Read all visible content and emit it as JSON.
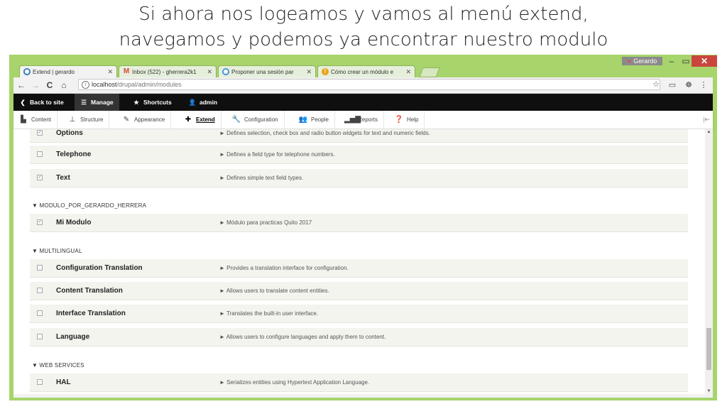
{
  "slide": {
    "title_line1": "Si ahora nos logeamos y vamos al menú extend,",
    "title_line2": "navegamos y podemos ya encontrar nuestro modulo"
  },
  "window": {
    "user": "Gerardo",
    "minimize": "–",
    "maximize": "▭",
    "close": "✕"
  },
  "tabs": [
    {
      "label": "Extend | gerardo",
      "icon": "drupal-icon",
      "color": "#2a73b8"
    },
    {
      "label": "Inbox (522) - gherrera2k1",
      "icon": "gmail-icon",
      "color": "#d44638"
    },
    {
      "label": "Proponer una sesión par",
      "icon": "drupal-icon",
      "color": "#3a8fd1"
    },
    {
      "label": "Cómo crear un módulo e",
      "icon": "info-icon",
      "color": "#e8a317"
    }
  ],
  "toolbar": {
    "back": "←",
    "forward": "→",
    "reload": "C",
    "home": "⌂",
    "url_host": "localhost",
    "url_path": "/drupal/admin/modules",
    "star": "☆"
  },
  "admin_bar": {
    "back_to_site": "Back to site",
    "manage": "Manage",
    "shortcuts": "Shortcuts",
    "admin": "admin"
  },
  "tray": {
    "items": [
      {
        "label": "Content",
        "icon": "file-icon"
      },
      {
        "label": "Structure",
        "icon": "sitemap-icon"
      },
      {
        "label": "Appearance",
        "icon": "paintbrush-icon"
      },
      {
        "label": "Extend",
        "icon": "puzzle-icon"
      },
      {
        "label": "Configuration",
        "icon": "wrench-icon"
      },
      {
        "label": "People",
        "icon": "people-icon"
      },
      {
        "label": "Reports",
        "icon": "bar-chart-icon"
      },
      {
        "label": "Help",
        "icon": "help-icon"
      }
    ],
    "active": "Extend",
    "collapse": "|⇤"
  },
  "modules": {
    "rows": [
      {
        "name": "Options",
        "desc": "Defines selection, check box and radio button widgets for text and numeric fields.",
        "checked": true
      },
      {
        "name": "Telephone",
        "desc": "Defines a field type for telephone numbers.",
        "checked": false
      },
      {
        "name": "Text",
        "desc": "Defines simple text field types.",
        "checked": true
      }
    ],
    "groups": [
      {
        "title": "MODULO_POR_GERARDO_HERRERA",
        "rows": [
          {
            "name": "Mi Modulo",
            "desc": "Módulo para practicas Quito 2017",
            "checked": true
          }
        ]
      },
      {
        "title": "MULTILINGUAL",
        "rows": [
          {
            "name": "Configuration Translation",
            "desc": "Provides a translation interface for configuration.",
            "checked": false
          },
          {
            "name": "Content Translation",
            "desc": "Allows users to translate content entities.",
            "checked": false
          },
          {
            "name": "Interface Translation",
            "desc": "Translates the built-in user interface.",
            "checked": false
          },
          {
            "name": "Language",
            "desc": "Allows users to configure languages and apply them to content.",
            "checked": false
          }
        ]
      },
      {
        "title": "WEB SERVICES",
        "rows": [
          {
            "name": "HAL",
            "desc": "Serializes entities using Hypertext Application Language.",
            "checked": false
          }
        ]
      }
    ]
  }
}
